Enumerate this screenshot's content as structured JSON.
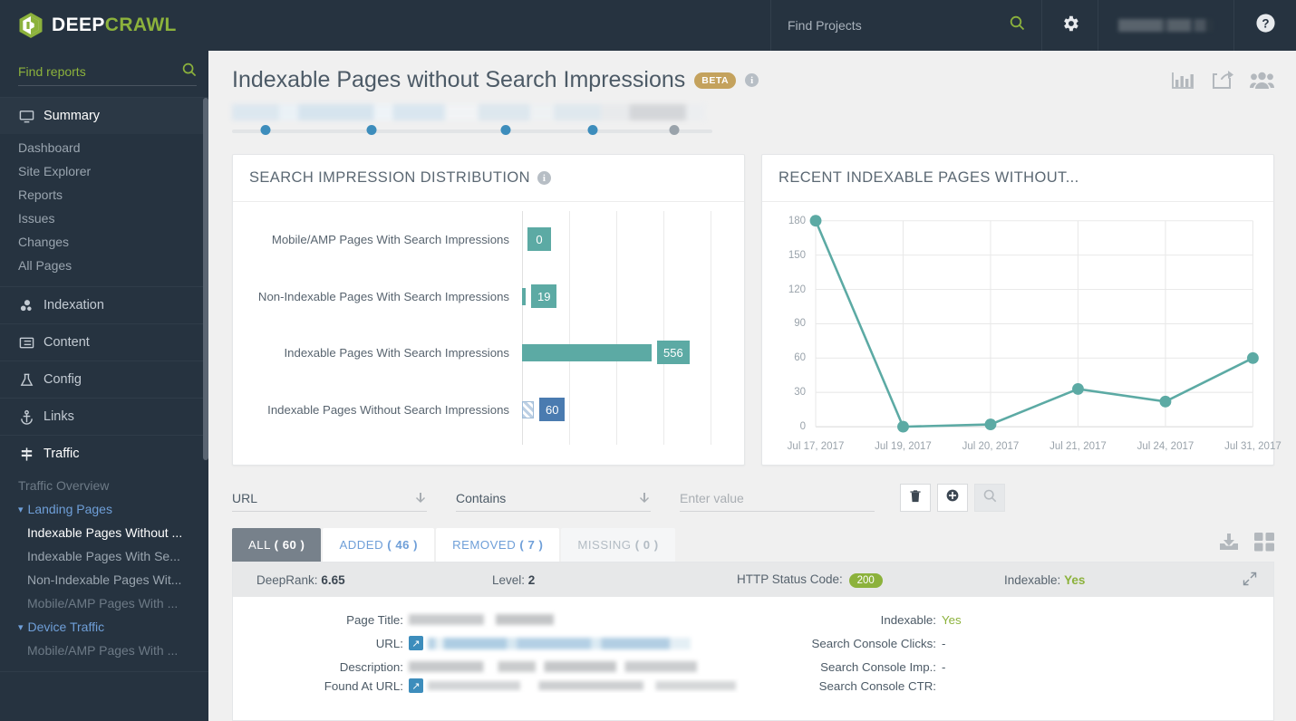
{
  "brand": {
    "word1": "DEEP",
    "word2": "CRAWL",
    "logo_icon": "hexagon-cube-logo"
  },
  "topbar": {
    "find_projects_placeholder": "Find Projects",
    "find_projects_value": "",
    "search_icon": "search-icon",
    "gear_icon": "gear-icon",
    "help_icon": "help-icon",
    "account_label": ""
  },
  "sidebar": {
    "find_reports_placeholder": "Find reports",
    "find_reports_value": "",
    "search_icon": "search-icon",
    "menu_icon": "hamburger-menu-icon",
    "summary": {
      "label": "Summary",
      "icon": "monitor-icon"
    },
    "summary_items": [
      "Dashboard",
      "Site Explorer",
      "Reports",
      "Issues",
      "Changes",
      "All Pages"
    ],
    "sections": [
      {
        "label": "Indexation",
        "icon": "indexation-icon"
      },
      {
        "label": "Content",
        "icon": "content-list-icon"
      },
      {
        "label": "Config",
        "icon": "flask-icon"
      },
      {
        "label": "Links",
        "icon": "anchor-icon"
      }
    ],
    "traffic": {
      "label": "Traffic",
      "icon": "signpost-icon"
    },
    "traffic_items": [
      {
        "label": "Traffic Overview",
        "type": "item",
        "state": "muted"
      },
      {
        "label": "Landing Pages",
        "type": "group",
        "state": "group"
      },
      {
        "label": "Indexable Pages Without ...",
        "type": "item",
        "state": "selected"
      },
      {
        "label": "Indexable Pages With Se...",
        "type": "item",
        "state": "normal"
      },
      {
        "label": "Non-Indexable Pages Wit...",
        "type": "item",
        "state": "normal"
      },
      {
        "label": "Mobile/AMP Pages With ...",
        "type": "item",
        "state": "muted"
      },
      {
        "label": "Device Traffic",
        "type": "group",
        "state": "group"
      },
      {
        "label": "Mobile/AMP Pages With ...",
        "type": "item",
        "state": "muted"
      }
    ]
  },
  "page": {
    "title": "Indexable Pages without Search Impressions",
    "badge": "BETA",
    "info_icon": "info-icon",
    "actions": [
      {
        "name": "chart-icon"
      },
      {
        "name": "share-icon"
      },
      {
        "name": "users-icon"
      }
    ],
    "timeline_dots": [
      7,
      29,
      57,
      75,
      92
    ]
  },
  "chart_data": [
    {
      "type": "bar",
      "title": "SEARCH IMPRESSION DISTRIBUTION",
      "orientation": "horizontal",
      "categories": [
        "Mobile/AMP Pages With Search Impressions",
        "Non-Indexable Pages With Search Impressions",
        "Indexable Pages With Search Impressions",
        "Indexable Pages Without Search Impressions"
      ],
      "values": [
        0,
        19,
        556,
        60
      ],
      "colors": [
        "#5caaa4",
        "#5caaa4",
        "#5caaa4",
        "#4a7bb0"
      ],
      "highlighted_index": 3,
      "xlabel": "",
      "ylabel": "",
      "grid": true,
      "xlim": [
        0,
        800
      ],
      "gridline_count": 5
    },
    {
      "type": "line",
      "title": "RECENT INDEXABLE PAGES WITHOUT...",
      "x": [
        "Jul 17, 2017",
        "Jul 19, 2017",
        "Jul 20, 2017",
        "Jul 21, 2017",
        "Jul 24, 2017",
        "Jul 31, 2017"
      ],
      "values": [
        180,
        0,
        2,
        33,
        22,
        60
      ],
      "yticks": [
        0,
        30,
        60,
        90,
        120,
        150,
        180
      ],
      "ylim": [
        0,
        180
      ],
      "color": "#5caaa4",
      "xlabel": "",
      "ylabel": "",
      "grid": true
    }
  ],
  "filters": {
    "field_label": "URL",
    "operator_label": "Contains",
    "value_placeholder": "Enter value",
    "value_text": "",
    "delete_icon": "trash-icon",
    "add_icon": "add-circle-icon",
    "search_icon": "search-icon",
    "dropdown_icon": "arrow-down-icon"
  },
  "tabs": [
    {
      "label": "ALL",
      "count": "( 60 )",
      "state": "active"
    },
    {
      "label": "ADDED",
      "count": "( 46 )",
      "state": "normal"
    },
    {
      "label": "REMOVED",
      "count": "( 7 )",
      "state": "normal"
    },
    {
      "label": "MISSING",
      "count": "( 0 )",
      "state": "disabled"
    }
  ],
  "tabs_right": [
    {
      "name": "download-icon"
    },
    {
      "name": "grid-view-icon"
    }
  ],
  "result": {
    "summary": {
      "deeprank_label": "DeepRank:",
      "deeprank_value": "6.65",
      "level_label": "Level:",
      "level_value": "2",
      "status_label": "HTTP Status Code:",
      "status_value": "200",
      "indexable_label": "Indexable:",
      "indexable_value": "Yes",
      "expand_icon": "expand-icon"
    },
    "left_rows": [
      {
        "label": "Page Title:",
        "kind": "blur-title"
      },
      {
        "label": "URL:",
        "kind": "blur-url",
        "icon": "external-link-icon"
      },
      {
        "label": "Description:",
        "kind": "blur-desc"
      },
      {
        "label": "Found At URL:",
        "kind": "cut",
        "icon": "external-link-icon"
      }
    ],
    "right_rows": [
      {
        "label": "Indexable:",
        "value": "Yes",
        "kind": "yes"
      },
      {
        "label": "Search Console Clicks:",
        "value": "-",
        "kind": "dash"
      },
      {
        "label": "Search Console Imp.:",
        "value": "-",
        "kind": "dash"
      },
      {
        "label": "Search Console CTR:",
        "value": "",
        "kind": "cut"
      }
    ]
  }
}
